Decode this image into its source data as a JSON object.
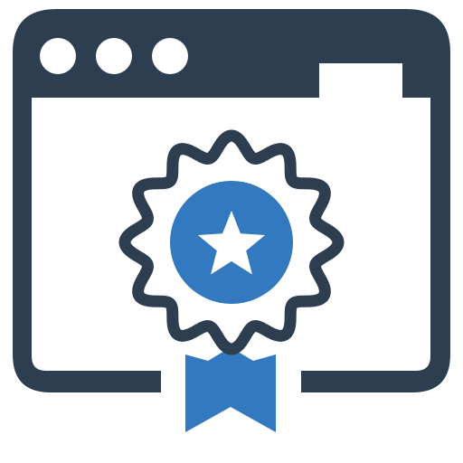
{
  "icon": {
    "name": "web-certificate-award-icon",
    "colors": {
      "frame": "#2d3e50",
      "accent": "#3279bf",
      "background": "#ffffff"
    },
    "window_dots": 3,
    "badge_symbol": "star-icon",
    "ribbon": "ribbon-icon"
  }
}
